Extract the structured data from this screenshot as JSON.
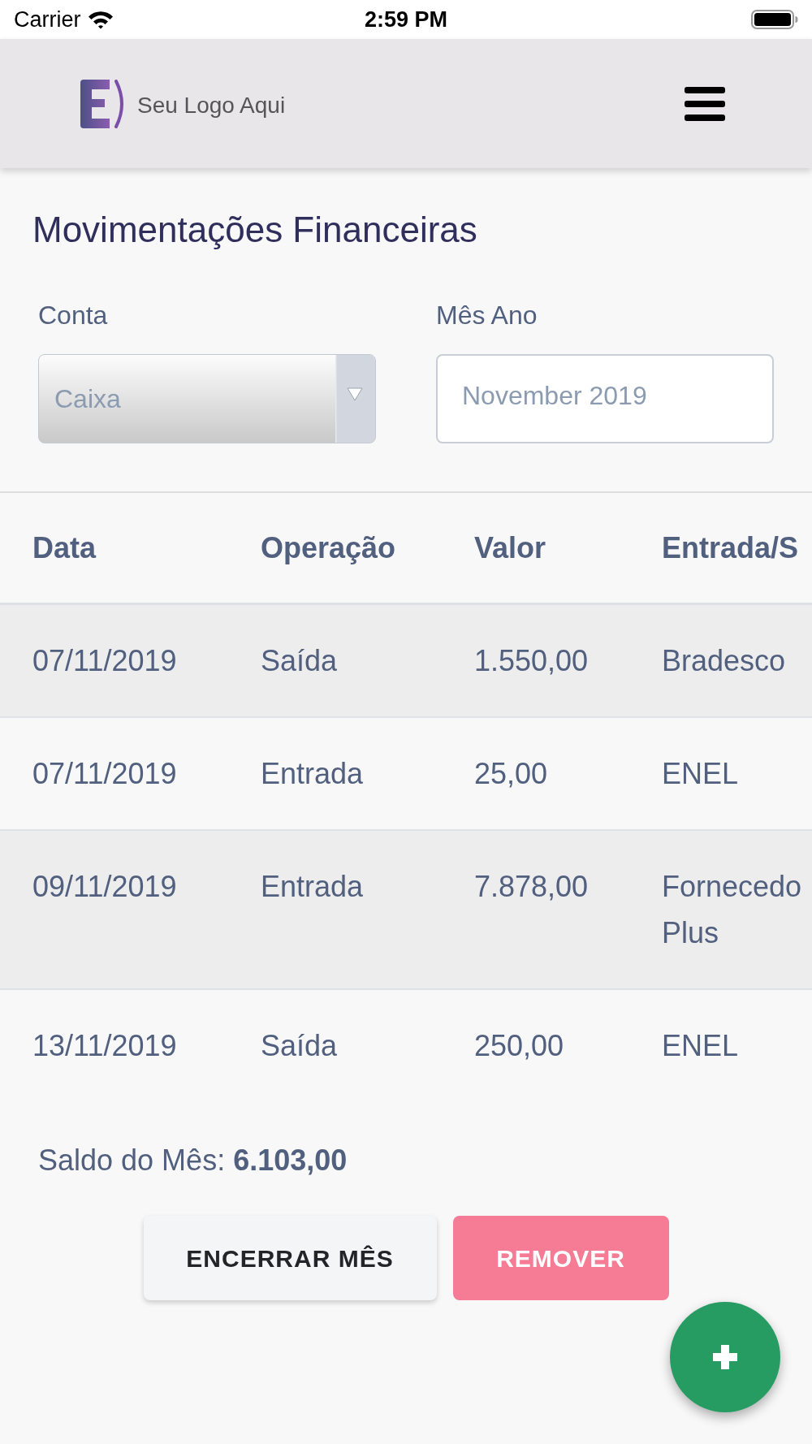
{
  "status_bar": {
    "carrier": "Carrier",
    "time": "2:59 PM"
  },
  "header": {
    "logo_text": "Seu Logo Aqui"
  },
  "page": {
    "title": "Movimentações Financeiras"
  },
  "filters": [
    {
      "kind": "select",
      "label": "Conta",
      "value": "Caixa"
    },
    {
      "kind": "month",
      "label": "Mês Ano",
      "value": "November 2019"
    }
  ],
  "table": {
    "columns": [
      "Data",
      "Operação",
      "Valor",
      "Entrada/S"
    ],
    "rows": [
      {
        "cells": [
          "07/11/2019",
          "Saída",
          "1.550,00",
          "Bradesco"
        ]
      },
      {
        "cells": [
          "07/11/2019",
          "Entrada",
          "25,00",
          "ENEL"
        ]
      },
      {
        "cells": [
          "09/11/2019",
          "Entrada",
          "7.878,00",
          "Fornecedo Plus"
        ]
      },
      {
        "cells": [
          "13/11/2019",
          "Saída",
          "250,00",
          "ENEL"
        ]
      }
    ]
  },
  "summary": {
    "text": "Saldo do Mês: **6.103,00**"
  },
  "buttons": [
    {
      "kind": "secondary",
      "label": "ENCERRAR MÊS"
    },
    {
      "kind": "danger",
      "label": "REMOVER"
    }
  ]
}
